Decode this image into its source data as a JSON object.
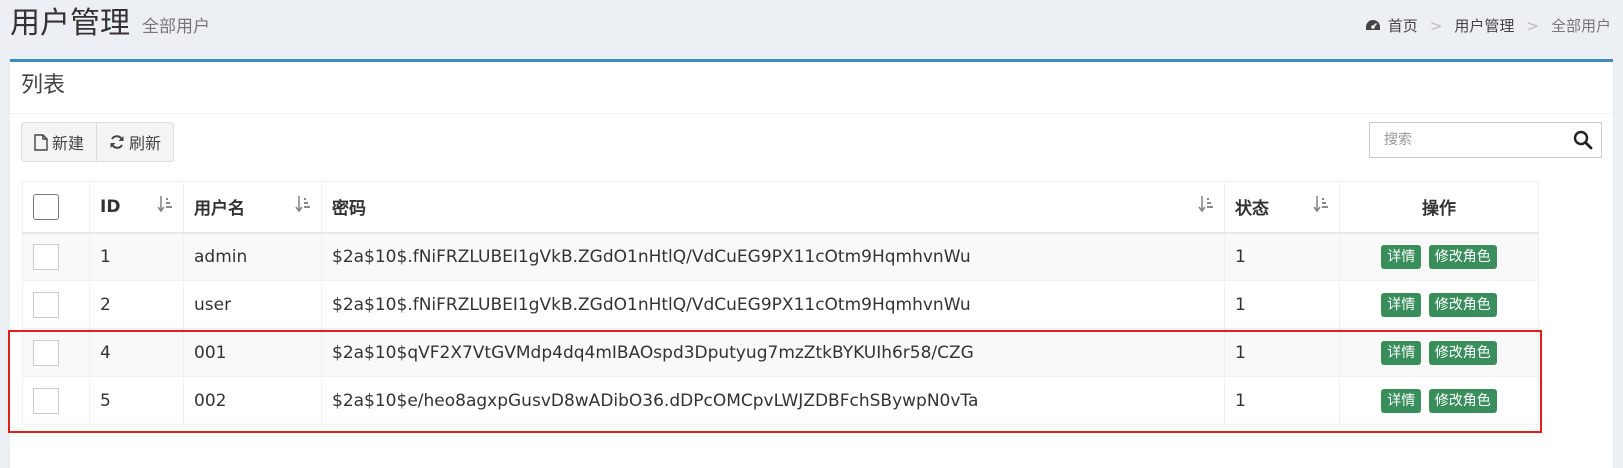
{
  "header": {
    "title": "用户管理",
    "subtitle": "全部用户",
    "breadcrumb": [
      "首页",
      "用户管理",
      "全部用户"
    ]
  },
  "box": {
    "title": "列表"
  },
  "toolbar": {
    "new_label": "新建",
    "refresh_label": "刷新"
  },
  "search": {
    "placeholder": "搜索"
  },
  "table": {
    "columns": [
      "ID",
      "用户名",
      "密码",
      "状态",
      "操作"
    ],
    "rows": [
      {
        "id": "1",
        "username": "admin",
        "password": "$2a$10$.fNiFRZLUBEI1gVkB.ZGdO1nHtlQ/VdCuEG9PX11cOtm9HqmhvnWu",
        "status": "1"
      },
      {
        "id": "2",
        "username": "user",
        "password": "$2a$10$.fNiFRZLUBEI1gVkB.ZGdO1nHtlQ/VdCuEG9PX11cOtm9HqmhvnWu",
        "status": "1"
      },
      {
        "id": "4",
        "username": "001",
        "password": "$2a$10$qVF2X7VtGVMdp4dq4mIBAOspd3Dputyug7mzZtkBYKUIh6r58/CZG",
        "status": "1"
      },
      {
        "id": "5",
        "username": "002",
        "password": "$2a$10$e/heo8agxpGusvD8wADibO36.dDPcOMCpvLWJZDBFchSBywpN0vTa",
        "status": "1"
      }
    ],
    "row_actions": {
      "detail_label": "详情",
      "edit_role_label": "修改角色"
    }
  },
  "colors": {
    "accent": "#3c8dbc",
    "action_button": "#398e5c",
    "highlight": "#e0201a"
  }
}
